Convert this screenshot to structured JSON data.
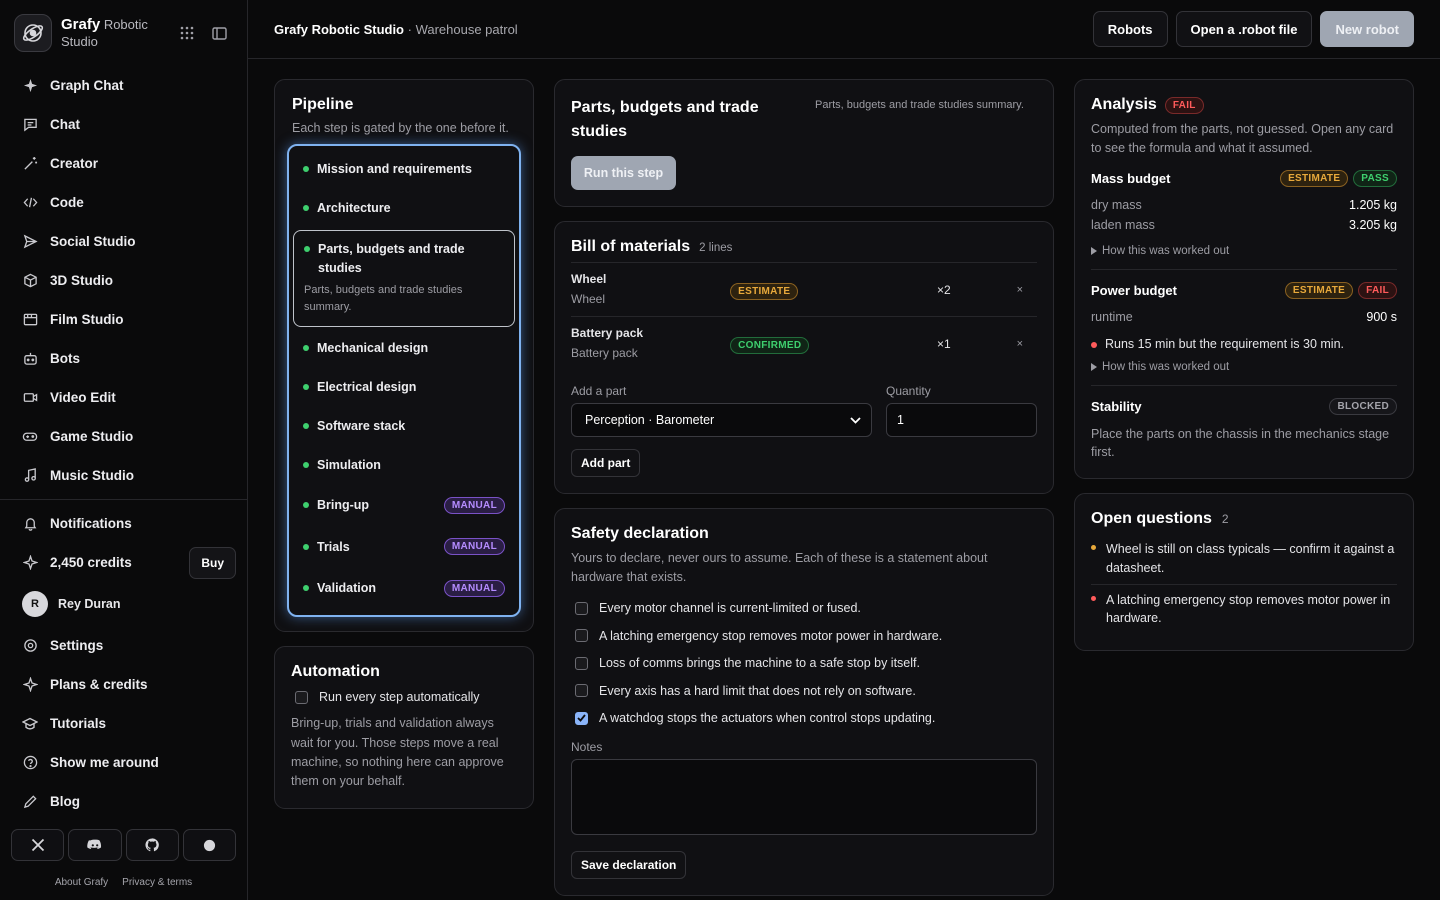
{
  "brand": {
    "name": "Grafy",
    "sub": "Robotic Studio"
  },
  "nav": [
    {
      "label": "Graph Chat",
      "icon": "sparkle-icon"
    },
    {
      "label": "Chat",
      "icon": "chat-icon"
    },
    {
      "label": "Creator",
      "icon": "wand-icon"
    },
    {
      "label": "Code",
      "icon": "code-icon"
    },
    {
      "label": "Social Studio",
      "icon": "send-icon"
    },
    {
      "label": "3D Studio",
      "icon": "cube-icon"
    },
    {
      "label": "Film Studio",
      "icon": "film-icon"
    },
    {
      "label": "Bots",
      "icon": "bot-icon"
    },
    {
      "label": "Video Edit",
      "icon": "video-icon"
    },
    {
      "label": "Game Studio",
      "icon": "gamepad-icon"
    },
    {
      "label": "Music Studio",
      "icon": "music-icon"
    }
  ],
  "nav2": {
    "notifications": "Notifications",
    "credits": "2,450 credits",
    "buy": "Buy",
    "user_initial": "R",
    "user": "Rey Duran",
    "settings": "Settings",
    "plans": "Plans & credits",
    "tutorials": "Tutorials",
    "tour": "Show me around",
    "blog": "Blog"
  },
  "footer": {
    "about": "About Grafy",
    "privacy": "Privacy & terms"
  },
  "topbar": {
    "app": "Grafy Robotic Studio",
    "project": "· Warehouse patrol",
    "robots": "Robots",
    "open_file": "Open a .robot file",
    "new_robot": "New robot"
  },
  "pipeline": {
    "title": "Pipeline",
    "subtitle": "Each step is gated by the one before it.",
    "steps": [
      {
        "label": "Mission and requirements"
      },
      {
        "label": "Architecture"
      },
      {
        "label": "Parts, budgets and trade studies",
        "desc": "Parts, budgets and trade studies summary."
      },
      {
        "label": "Mechanical design"
      },
      {
        "label": "Electrical design"
      },
      {
        "label": "Software stack"
      },
      {
        "label": "Simulation"
      },
      {
        "label": "Bring-up",
        "badge": "MANUAL"
      },
      {
        "label": "Trials",
        "badge": "MANUAL"
      },
      {
        "label": "Validation",
        "badge": "MANUAL"
      }
    ]
  },
  "automation": {
    "title": "Automation",
    "checkbox": "Run every step automatically",
    "desc": "Bring-up, trials and validation always wait for you. Those steps move a real machine, so nothing here can approve them on your behalf."
  },
  "step_card": {
    "title": "Parts, budgets and trade studies",
    "summary": "Parts, budgets and trade studies summary.",
    "run": "Run this step"
  },
  "bom": {
    "title": "Bill of materials",
    "count": "2 lines",
    "rows": [
      {
        "name": "Wheel",
        "sub": "Wheel",
        "badge": "ESTIMATE",
        "qty": "×2",
        "remove": "×"
      },
      {
        "name": "Battery pack",
        "sub": "Battery pack",
        "badge": "CONFIRMED",
        "qty": "×1",
        "remove": "×"
      }
    ],
    "add_label": "Add a part",
    "qty_label": "Quantity",
    "select_value": "Perception · Barometer",
    "qty_value": "1",
    "add_btn": "Add part"
  },
  "safety": {
    "title": "Safety declaration",
    "desc": "Yours to declare, never ours to assume. Each of these is a statement about hardware that exists.",
    "items": [
      {
        "label": "Every motor channel is current-limited or fused.",
        "checked": false
      },
      {
        "label": "A latching emergency stop removes motor power in hardware.",
        "checked": false
      },
      {
        "label": "Loss of comms brings the machine to a safe stop by itself.",
        "checked": false
      },
      {
        "label": "Every axis has a hard limit that does not rely on software.",
        "checked": false
      },
      {
        "label": "A watchdog stops the actuators when control stops updating.",
        "checked": true
      }
    ],
    "notes_label": "Notes",
    "save": "Save declaration"
  },
  "analysis": {
    "title": "Analysis",
    "status": "FAIL",
    "desc": "Computed from the parts, not guessed. Open any card to see the formula and what it assumed.",
    "mass": {
      "title": "Mass budget",
      "b1": "ESTIMATE",
      "b2": "PASS",
      "rows": [
        {
          "k": "dry mass",
          "v": "1.205 kg"
        },
        {
          "k": "laden mass",
          "v": "3.205 kg"
        }
      ],
      "how": "How this was worked out"
    },
    "power": {
      "title": "Power budget",
      "b1": "ESTIMATE",
      "b2": "FAIL",
      "rows": [
        {
          "k": "runtime",
          "v": "900 s"
        }
      ],
      "warn": "Runs 15 min but the requirement is 30 min.",
      "how": "How this was worked out"
    },
    "stability": {
      "title": "Stability",
      "badge": "BLOCKED",
      "desc": "Place the parts on the chassis in the mechanics stage first."
    }
  },
  "questions": {
    "title": "Open questions",
    "count": "2",
    "items": [
      {
        "text": "Wheel is still on class typicals — confirm it against a datasheet.",
        "color": "#e8a93b"
      },
      {
        "text": "A latching emergency stop removes motor power in hardware.",
        "color": "#ff5b5b"
      }
    ]
  }
}
